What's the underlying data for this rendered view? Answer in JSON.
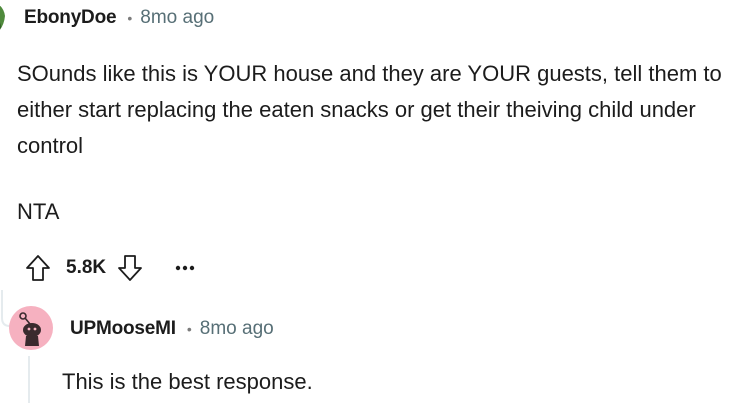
{
  "comment": {
    "username": "EbonyDoe",
    "separator": "•",
    "time": "8mo ago",
    "body_paragraph_1": "SOunds like this is YOUR house and they are YOUR guests, tell them to either start replacing the eaten snacks or get their theiving child under control",
    "body_paragraph_2": "NTA",
    "score": "5.8K",
    "more_label": "•••"
  },
  "reply": {
    "username": "UPMooseMI",
    "separator": "•",
    "time": "8mo ago",
    "body": "This is the best response."
  },
  "colors": {
    "avatar_pink": "#f6b1c0",
    "avatar_dark": "#3a2a2e",
    "thread_line": "#e5ebee",
    "meta_gray": "#576f76"
  }
}
